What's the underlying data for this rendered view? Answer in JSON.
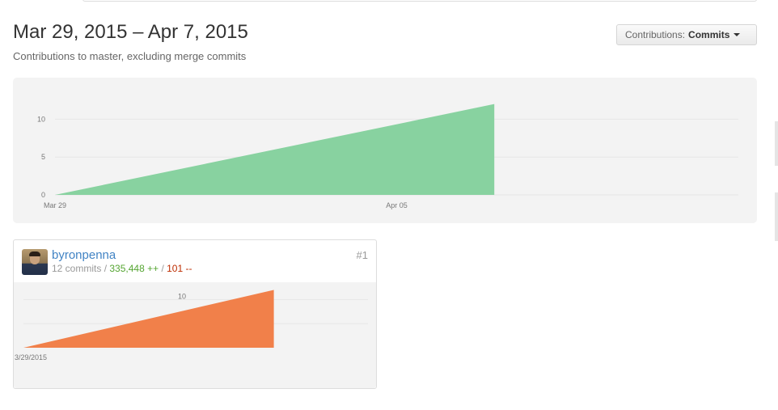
{
  "header": {
    "title": "Mar 29, 2015 – Apr 7, 2015",
    "subtitle": "Contributions to master, excluding merge commits"
  },
  "contributions_selector": {
    "label": "Contributions:",
    "value": "Commits"
  },
  "colors": {
    "main_area": "#88d2a0",
    "contributor_area": "#f1804a",
    "link": "#4183c4",
    "additions": "#55a532",
    "deletions": "#bd2c00"
  },
  "chart_data": [
    {
      "type": "area",
      "x": [
        "2015-03-29",
        "2015-04-07"
      ],
      "values": [
        0,
        12
      ],
      "y_ticks": [
        "0",
        "5",
        "10"
      ],
      "x_tick_labels": [
        "Mar 29",
        "Apr 05"
      ],
      "ylim": [
        0,
        12
      ],
      "grid": true
    },
    {
      "type": "area",
      "x": [
        "2015-03-29",
        "2015-04-07"
      ],
      "values": [
        0,
        12
      ],
      "y_ticks": [
        "10"
      ],
      "x_tick_labels": [
        "3/29/2015"
      ],
      "grid": true
    }
  ],
  "contributors": [
    {
      "name": "byronpenna",
      "commits": "12 commits",
      "separator": " / ",
      "additions": "335,448 ++",
      "deletions": "101 --",
      "rank": "#1"
    }
  ]
}
